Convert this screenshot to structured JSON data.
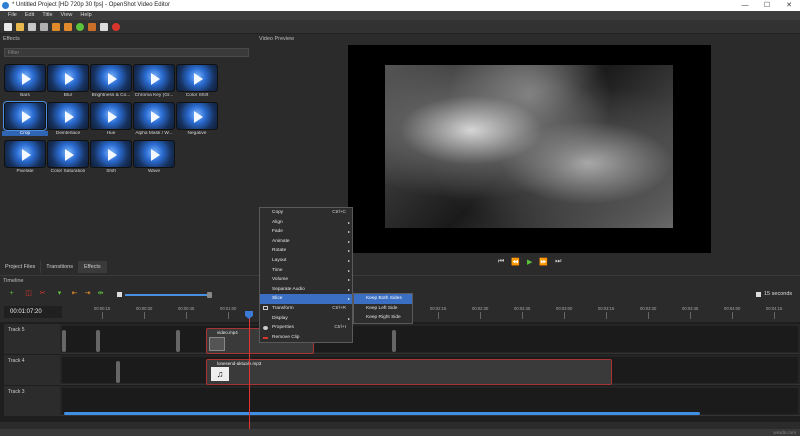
{
  "window": {
    "title": "* Untitled Project [HD 720p 30 fps] - OpenShot Video Editor",
    "controls": [
      "—",
      "☐",
      "✕"
    ]
  },
  "menubar": [
    "File",
    "Edit",
    "Title",
    "View",
    "Help"
  ],
  "effects": {
    "title": "Effects",
    "filter_placeholder": "Filter",
    "items": [
      {
        "label": "Bars"
      },
      {
        "label": "Blur"
      },
      {
        "label": "Brightness & Co..."
      },
      {
        "label": "Chroma Key (Gr..."
      },
      {
        "label": "Color Shift"
      },
      {
        "label": "Crop",
        "selected": true
      },
      {
        "label": "Deinterlace"
      },
      {
        "label": "Hue"
      },
      {
        "label": "Alpha Mask / W..."
      },
      {
        "label": "Negative"
      },
      {
        "label": "Pixelate"
      },
      {
        "label": "Color Saturation"
      },
      {
        "label": "Shift"
      },
      {
        "label": "Wave"
      }
    ],
    "tabs": [
      "Project Files",
      "Transitions",
      "Effects"
    ]
  },
  "preview": {
    "title": "Video Preview",
    "controls": [
      "⏮",
      "⏪",
      "▶",
      "⏩",
      "⏭"
    ]
  },
  "timeline": {
    "title": "Timeline",
    "timecode": "00:01:07:20",
    "zoom_label": "15 seconds",
    "ruler": [
      "00:00:15",
      "00:00:30",
      "00:00:45",
      "00:01:00",
      "00:01:15",
      "00:01:30",
      "00:01:45",
      "00:02:00",
      "00:02:15",
      "00:02:30",
      "00:02:45",
      "00:03:00",
      "00:03:15",
      "00:03:30",
      "00:03:45",
      "00:04:00",
      "00:04:15"
    ],
    "tracks": [
      {
        "name": "Track 5",
        "clip": "video.mp4"
      },
      {
        "name": "Track 4",
        "clip": "lonesend-aktuale.mp3"
      },
      {
        "name": "Track 3",
        "clip": ""
      }
    ]
  },
  "context_menu": {
    "items": [
      {
        "label": "Copy",
        "shortcut": "Ctrl+C",
        "arrow": ""
      },
      {
        "label": "Align",
        "shortcut": "",
        "arrow": "▸"
      },
      {
        "label": "Fade",
        "shortcut": "",
        "arrow": "▸"
      },
      {
        "label": "Animate",
        "shortcut": "",
        "arrow": "▸"
      },
      {
        "label": "Rotate",
        "shortcut": "",
        "arrow": "▸"
      },
      {
        "label": "Layout",
        "shortcut": "",
        "arrow": "▸"
      },
      {
        "label": "Time",
        "shortcut": "",
        "arrow": "▸"
      },
      {
        "label": "Volume",
        "shortcut": "",
        "arrow": "▸"
      },
      {
        "label": "Separate Audio",
        "shortcut": "",
        "arrow": "▸"
      },
      {
        "label": "Slice",
        "shortcut": "",
        "arrow": "▸",
        "highlighted": true
      },
      {
        "label": "Transform",
        "shortcut": "Ctrl+R",
        "arrow": ""
      },
      {
        "label": "Display",
        "shortcut": "",
        "arrow": "▸"
      },
      {
        "label": "Properties",
        "shortcut": "Ctrl+I",
        "arrow": ""
      },
      {
        "label": "Remove Clip",
        "shortcut": "",
        "arrow": ""
      }
    ],
    "submenu": [
      "Keep Both Sides",
      "Keep Left Side",
      "Keep Right Side"
    ]
  },
  "watermark": "wsxdn.com",
  "colors": {
    "accent": "#3a6fc4",
    "playhead": "#e03333",
    "play": "#5cc23b"
  }
}
